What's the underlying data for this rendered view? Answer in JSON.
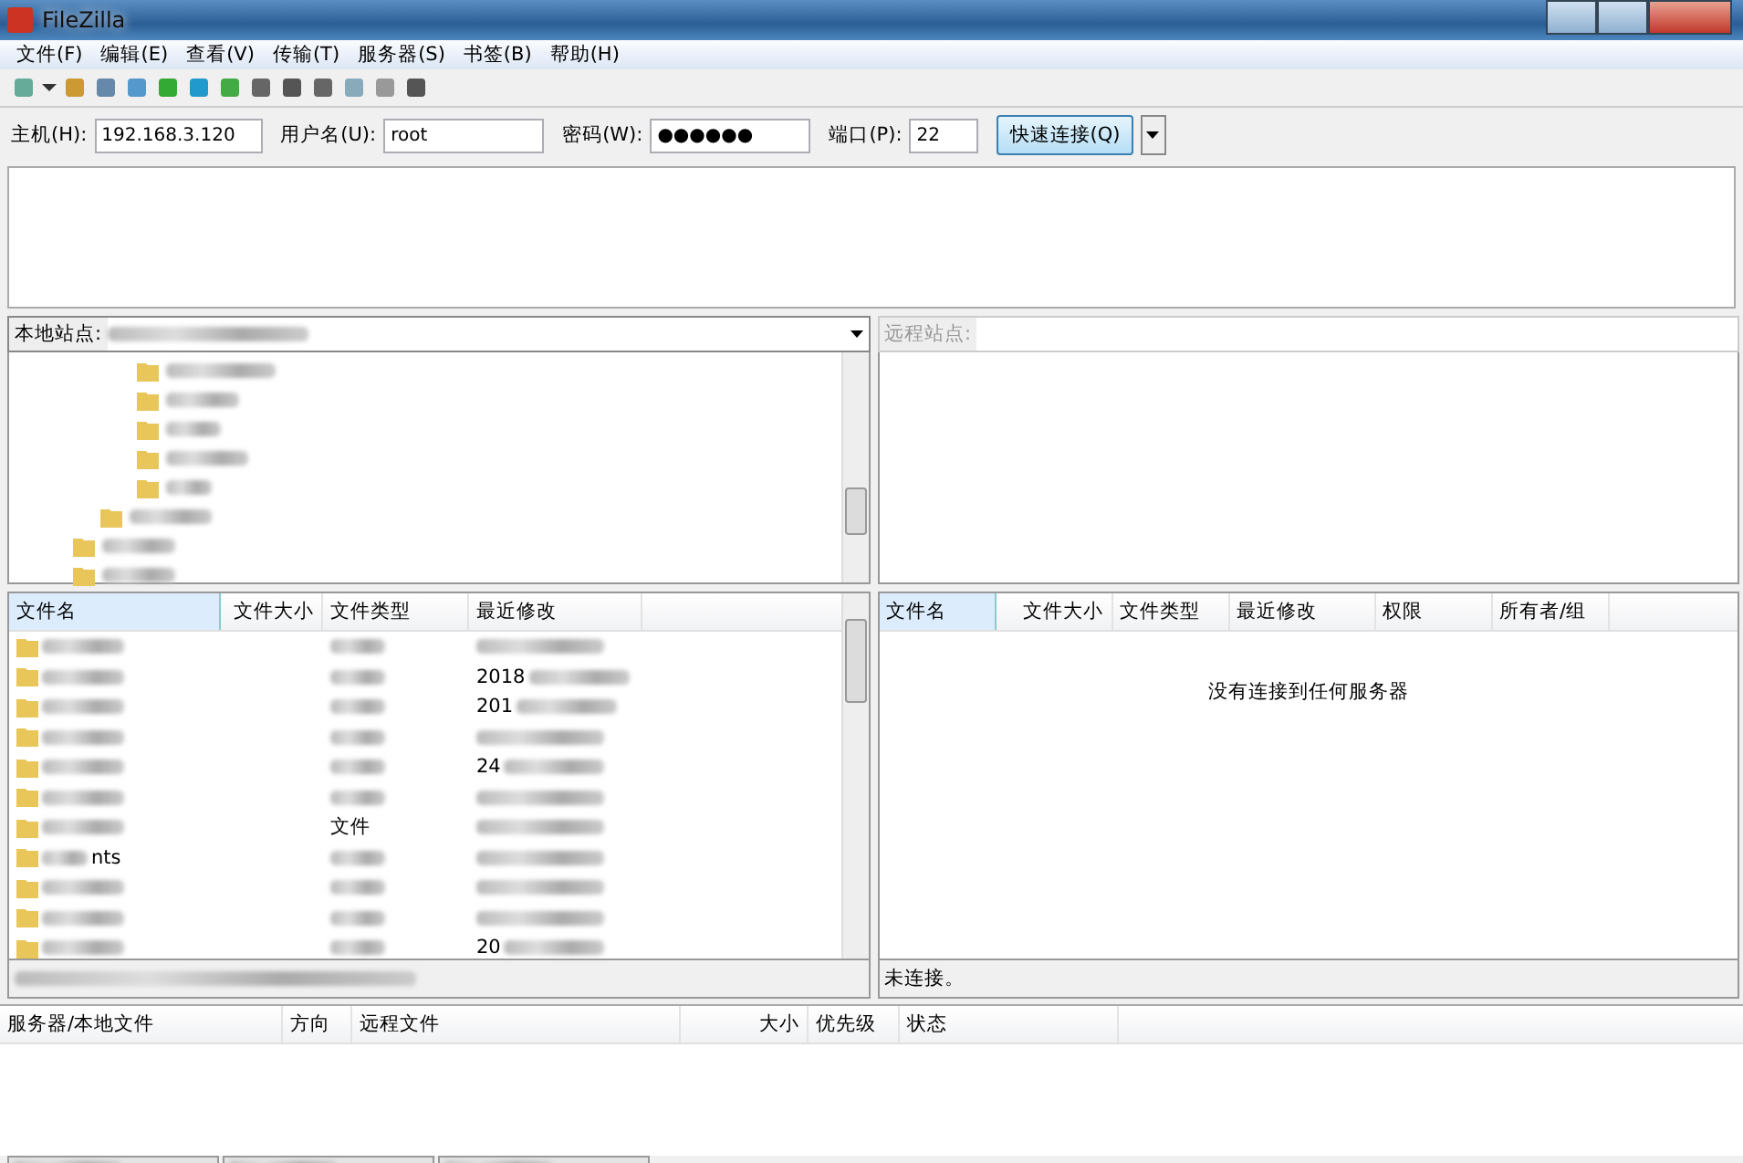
{
  "window": {
    "title": "FileZilla"
  },
  "menu": [
    "文件(F)",
    "编辑(E)",
    "查看(V)",
    "传输(T)",
    "服务器(S)",
    "书签(B)",
    "帮助(H)"
  ],
  "quickconnect": {
    "host_label": "主机(H):",
    "host": "192.168.3.120",
    "user_label": "用户名(U):",
    "user": "root",
    "password_label": "密码(W):",
    "password": "●●●●●●",
    "port_label": "端口(P):",
    "port": "22",
    "connect_button": "快速连接(Q)"
  },
  "local": {
    "site_label": "本地站点:",
    "columns": [
      "文件名",
      "文件大小",
      "文件类型",
      "最近修改"
    ],
    "rows": [
      {
        "name": "",
        "type": "",
        "modified": ""
      },
      {
        "name": "",
        "type": "",
        "modified": "2018"
      },
      {
        "name": "",
        "type": "",
        "modified": "201"
      },
      {
        "name": "",
        "type": "",
        "modified": ""
      },
      {
        "name": "",
        "type": "",
        "modified": "24"
      },
      {
        "name": "",
        "type": "",
        "modified": ""
      },
      {
        "name": "",
        "type": "文件",
        "modified": ""
      },
      {
        "name": "nts",
        "type": "",
        "modified": ""
      },
      {
        "name": "",
        "type": "",
        "modified": ""
      },
      {
        "name": "",
        "type": "",
        "modified": ""
      },
      {
        "name": "",
        "type": "",
        "modified": "20"
      }
    ]
  },
  "remote": {
    "site_label": "远程站点:",
    "columns": [
      "文件名",
      "文件大小",
      "文件类型",
      "最近修改",
      "权限",
      "所有者/组"
    ],
    "empty_message": "没有连接到任何服务器",
    "status": "未连接。"
  },
  "queue": {
    "columns": [
      "服务器/本地文件",
      "方向",
      "远程文件",
      "大小",
      "优先级",
      "状态"
    ]
  }
}
